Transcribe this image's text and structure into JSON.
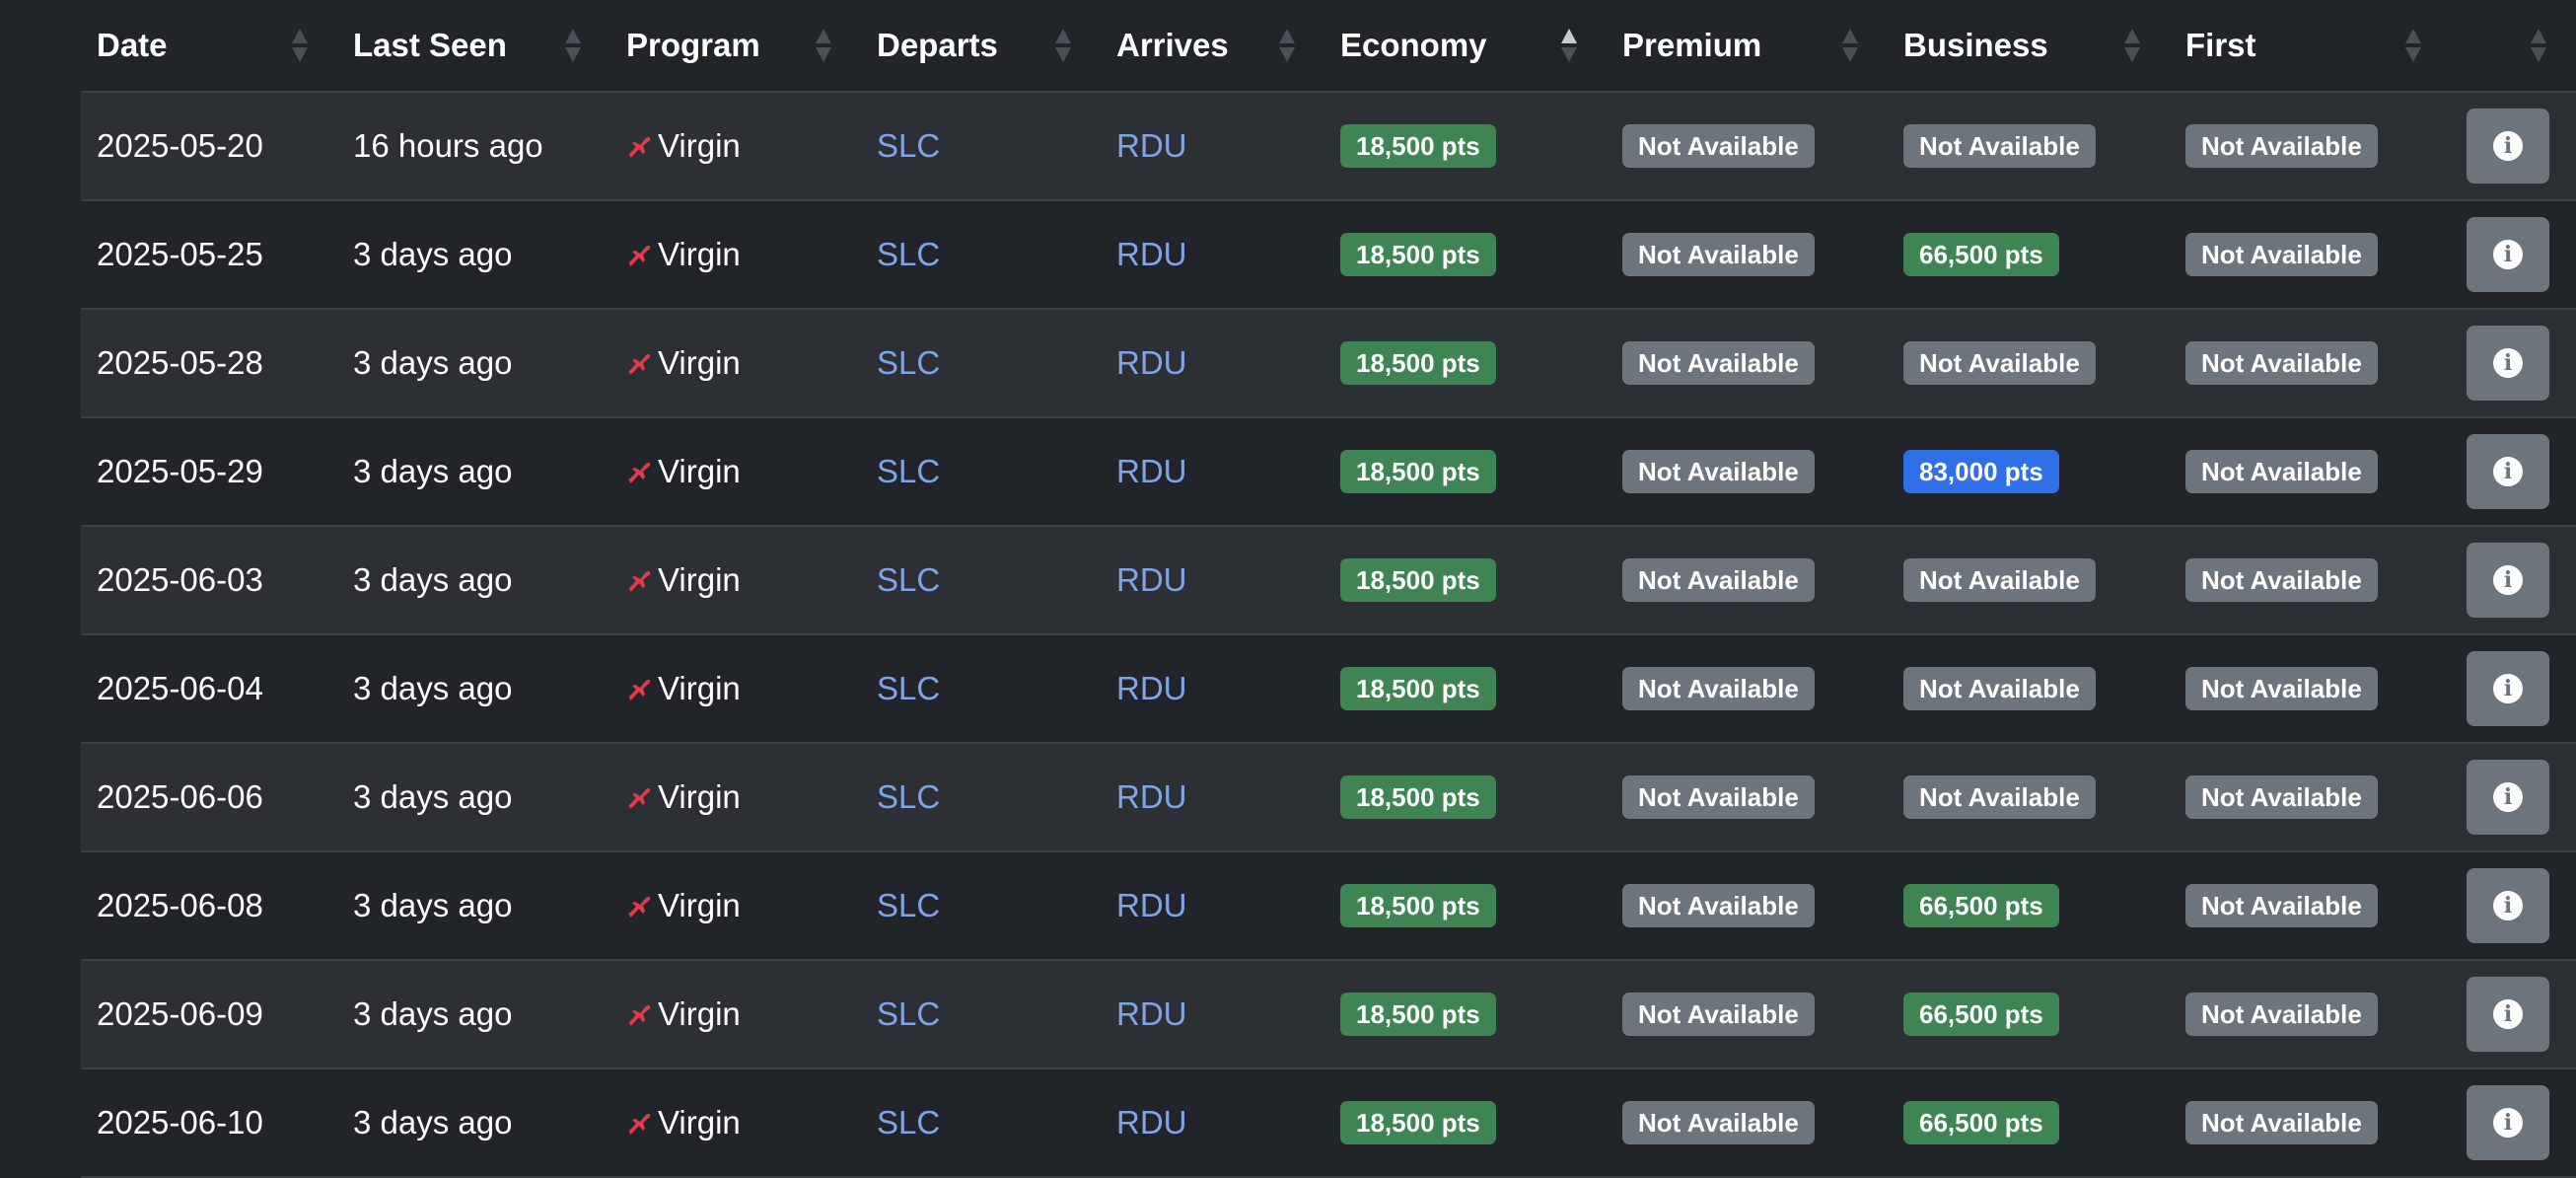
{
  "colors": {
    "available": "#3f8453",
    "available_alt": "#2f6fe8",
    "unavailable": "#6c757d",
    "link": "#7fa5e8",
    "program_icon": "#e8394a"
  },
  "table": {
    "columns": [
      {
        "label": "Date",
        "sortable": true,
        "sorted": false
      },
      {
        "label": "Last Seen",
        "sortable": true,
        "sorted": false
      },
      {
        "label": "Program",
        "sortable": true,
        "sorted": false
      },
      {
        "label": "Departs",
        "sortable": true,
        "sorted": false
      },
      {
        "label": "Arrives",
        "sortable": true,
        "sorted": false
      },
      {
        "label": "Economy",
        "sortable": true,
        "sorted": "asc"
      },
      {
        "label": "Premium",
        "sortable": true,
        "sorted": false
      },
      {
        "label": "Business",
        "sortable": true,
        "sorted": false
      },
      {
        "label": "First",
        "sortable": true,
        "sorted": false
      },
      {
        "label": "",
        "sortable": true,
        "sorted": false
      }
    ],
    "rows": [
      {
        "date": "2025-05-20",
        "last_seen": "16 hours ago",
        "program": "Virgin",
        "program_icon": "virgin-plane-icon",
        "departs": "SLC",
        "arrives": "RDU",
        "economy": {
          "text": "18,500 pts",
          "status": "available"
        },
        "premium": {
          "text": "Not Available",
          "status": "unavailable"
        },
        "business": {
          "text": "Not Available",
          "status": "unavailable"
        },
        "first": {
          "text": "Not Available",
          "status": "unavailable"
        }
      },
      {
        "date": "2025-05-25",
        "last_seen": "3 days ago",
        "program": "Virgin",
        "program_icon": "virgin-plane-icon",
        "departs": "SLC",
        "arrives": "RDU",
        "economy": {
          "text": "18,500 pts",
          "status": "available"
        },
        "premium": {
          "text": "Not Available",
          "status": "unavailable"
        },
        "business": {
          "text": "66,500 pts",
          "status": "available"
        },
        "first": {
          "text": "Not Available",
          "status": "unavailable"
        }
      },
      {
        "date": "2025-05-28",
        "last_seen": "3 days ago",
        "program": "Virgin",
        "program_icon": "virgin-plane-icon",
        "departs": "SLC",
        "arrives": "RDU",
        "economy": {
          "text": "18,500 pts",
          "status": "available"
        },
        "premium": {
          "text": "Not Available",
          "status": "unavailable"
        },
        "business": {
          "text": "Not Available",
          "status": "unavailable"
        },
        "first": {
          "text": "Not Available",
          "status": "unavailable"
        }
      },
      {
        "date": "2025-05-29",
        "last_seen": "3 days ago",
        "program": "Virgin",
        "program_icon": "virgin-plane-icon",
        "departs": "SLC",
        "arrives": "RDU",
        "economy": {
          "text": "18,500 pts",
          "status": "available"
        },
        "premium": {
          "text": "Not Available",
          "status": "unavailable"
        },
        "business": {
          "text": "83,000 pts",
          "status": "available_alt"
        },
        "first": {
          "text": "Not Available",
          "status": "unavailable"
        }
      },
      {
        "date": "2025-06-03",
        "last_seen": "3 days ago",
        "program": "Virgin",
        "program_icon": "virgin-plane-icon",
        "departs": "SLC",
        "arrives": "RDU",
        "economy": {
          "text": "18,500 pts",
          "status": "available"
        },
        "premium": {
          "text": "Not Available",
          "status": "unavailable"
        },
        "business": {
          "text": "Not Available",
          "status": "unavailable"
        },
        "first": {
          "text": "Not Available",
          "status": "unavailable"
        }
      },
      {
        "date": "2025-06-04",
        "last_seen": "3 days ago",
        "program": "Virgin",
        "program_icon": "virgin-plane-icon",
        "departs": "SLC",
        "arrives": "RDU",
        "economy": {
          "text": "18,500 pts",
          "status": "available"
        },
        "premium": {
          "text": "Not Available",
          "status": "unavailable"
        },
        "business": {
          "text": "Not Available",
          "status": "unavailable"
        },
        "first": {
          "text": "Not Available",
          "status": "unavailable"
        }
      },
      {
        "date": "2025-06-06",
        "last_seen": "3 days ago",
        "program": "Virgin",
        "program_icon": "virgin-plane-icon",
        "departs": "SLC",
        "arrives": "RDU",
        "economy": {
          "text": "18,500 pts",
          "status": "available"
        },
        "premium": {
          "text": "Not Available",
          "status": "unavailable"
        },
        "business": {
          "text": "Not Available",
          "status": "unavailable"
        },
        "first": {
          "text": "Not Available",
          "status": "unavailable"
        }
      },
      {
        "date": "2025-06-08",
        "last_seen": "3 days ago",
        "program": "Virgin",
        "program_icon": "virgin-plane-icon",
        "departs": "SLC",
        "arrives": "RDU",
        "economy": {
          "text": "18,500 pts",
          "status": "available"
        },
        "premium": {
          "text": "Not Available",
          "status": "unavailable"
        },
        "business": {
          "text": "66,500 pts",
          "status": "available"
        },
        "first": {
          "text": "Not Available",
          "status": "unavailable"
        }
      },
      {
        "date": "2025-06-09",
        "last_seen": "3 days ago",
        "program": "Virgin",
        "program_icon": "virgin-plane-icon",
        "departs": "SLC",
        "arrives": "RDU",
        "economy": {
          "text": "18,500 pts",
          "status": "available"
        },
        "premium": {
          "text": "Not Available",
          "status": "unavailable"
        },
        "business": {
          "text": "66,500 pts",
          "status": "available"
        },
        "first": {
          "text": "Not Available",
          "status": "unavailable"
        }
      },
      {
        "date": "2025-06-10",
        "last_seen": "3 days ago",
        "program": "Virgin",
        "program_icon": "virgin-plane-icon",
        "departs": "SLC",
        "arrives": "RDU",
        "economy": {
          "text": "18,500 pts",
          "status": "available"
        },
        "premium": {
          "text": "Not Available",
          "status": "unavailable"
        },
        "business": {
          "text": "66,500 pts",
          "status": "available"
        },
        "first": {
          "text": "Not Available",
          "status": "unavailable"
        }
      }
    ],
    "row_action_icon": "info-icon"
  }
}
